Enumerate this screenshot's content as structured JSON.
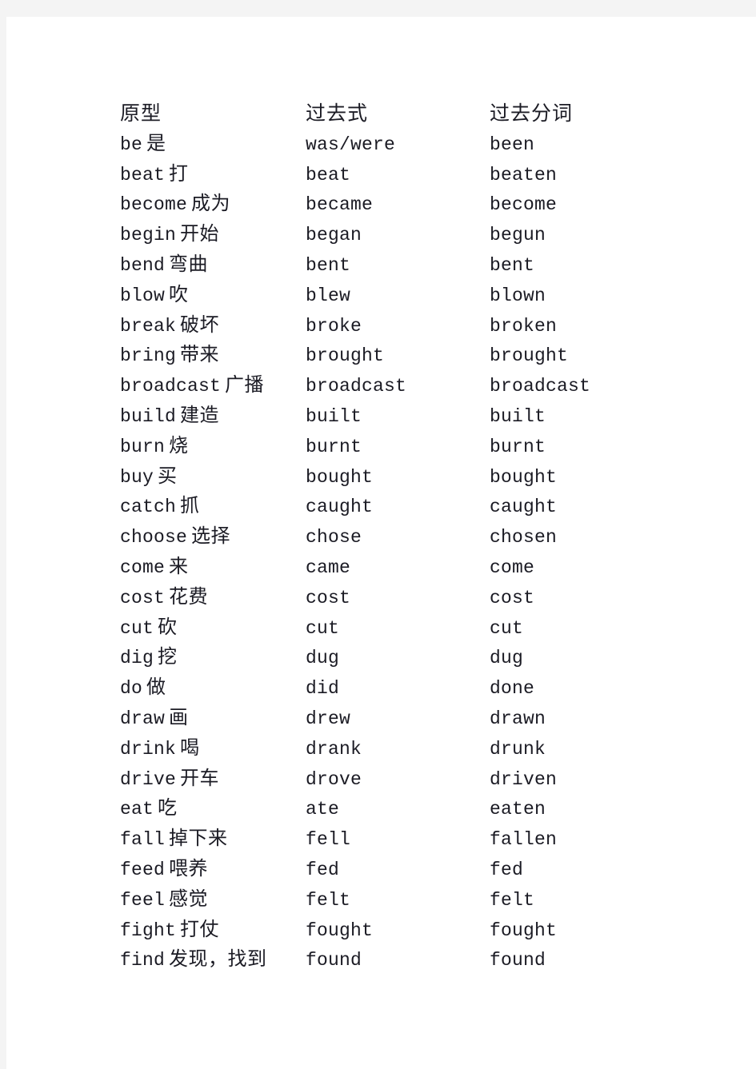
{
  "page": {
    "background_color": "#f4f4f4",
    "paper_color": "#ffffff",
    "text_color": "#1b1b24"
  },
  "table": {
    "headers": {
      "base_form": "原型",
      "past_tense": "过去式",
      "past_participle": "过去分词"
    },
    "rows": [
      {
        "base_en": "be",
        "base_zh": "是",
        "past": "was/were",
        "participle": "been"
      },
      {
        "base_en": "beat",
        "base_zh": "打",
        "past": "beat",
        "participle": "beaten"
      },
      {
        "base_en": "become",
        "base_zh": "成为",
        "past": "became",
        "participle": "become"
      },
      {
        "base_en": "begin",
        "base_zh": "开始",
        "past": "began",
        "participle": "begun"
      },
      {
        "base_en": "bend",
        "base_zh": "弯曲",
        "past": "bent",
        "participle": "bent"
      },
      {
        "base_en": "blow",
        "base_zh": "吹",
        "past": "blew",
        "participle": "blown"
      },
      {
        "base_en": "break",
        "base_zh": "破坏",
        "past": "broke",
        "participle": "broken"
      },
      {
        "base_en": "bring",
        "base_zh": "带来",
        "past": "brought",
        "participle": "brought"
      },
      {
        "base_en": "broadcast",
        "base_zh": "广播",
        "past": "broadcast",
        "participle": "broadcast"
      },
      {
        "base_en": "build",
        "base_zh": "建造",
        "past": "built",
        "participle": "built"
      },
      {
        "base_en": "burn",
        "base_zh": "烧",
        "past": "burnt",
        "participle": "burnt"
      },
      {
        "base_en": "buy",
        "base_zh": "买",
        "past": "bought",
        "participle": "bought"
      },
      {
        "base_en": "catch",
        "base_zh": "抓",
        "past": "caught",
        "participle": "caught"
      },
      {
        "base_en": "choose",
        "base_zh": "选择",
        "past": "chose",
        "participle": "chosen"
      },
      {
        "base_en": "come",
        "base_zh": "来",
        "past": "came",
        "participle": "come"
      },
      {
        "base_en": "cost",
        "base_zh": "花费",
        "past": "cost",
        "participle": "cost"
      },
      {
        "base_en": "cut",
        "base_zh": "砍",
        "past": "cut",
        "participle": "cut"
      },
      {
        "base_en": "dig",
        "base_zh": "挖",
        "past": "dug",
        "participle": "dug"
      },
      {
        "base_en": "do",
        "base_zh": "做",
        "past": "did",
        "participle": "done"
      },
      {
        "base_en": "draw",
        "base_zh": "画",
        "past": "drew",
        "participle": "drawn"
      },
      {
        "base_en": "drink",
        "base_zh": "喝",
        "past": "drank",
        "participle": "drunk"
      },
      {
        "base_en": "drive",
        "base_zh": "开车",
        "past": "drove",
        "participle": "driven"
      },
      {
        "base_en": "eat",
        "base_zh": "吃",
        "past": "ate",
        "participle": "eaten"
      },
      {
        "base_en": "fall",
        "base_zh": "掉下来",
        "past": "fell",
        "participle": "fallen"
      },
      {
        "base_en": "feed",
        "base_zh": "喂养",
        "past": "fed",
        "participle": "fed"
      },
      {
        "base_en": "feel",
        "base_zh": "感觉",
        "past": "felt",
        "participle": "felt"
      },
      {
        "base_en": "fight",
        "base_zh": "打仗",
        "past": "fought",
        "participle": "fought"
      },
      {
        "base_en": "find",
        "base_zh": "发现，找到",
        "past": "found",
        "participle": "found"
      }
    ]
  }
}
